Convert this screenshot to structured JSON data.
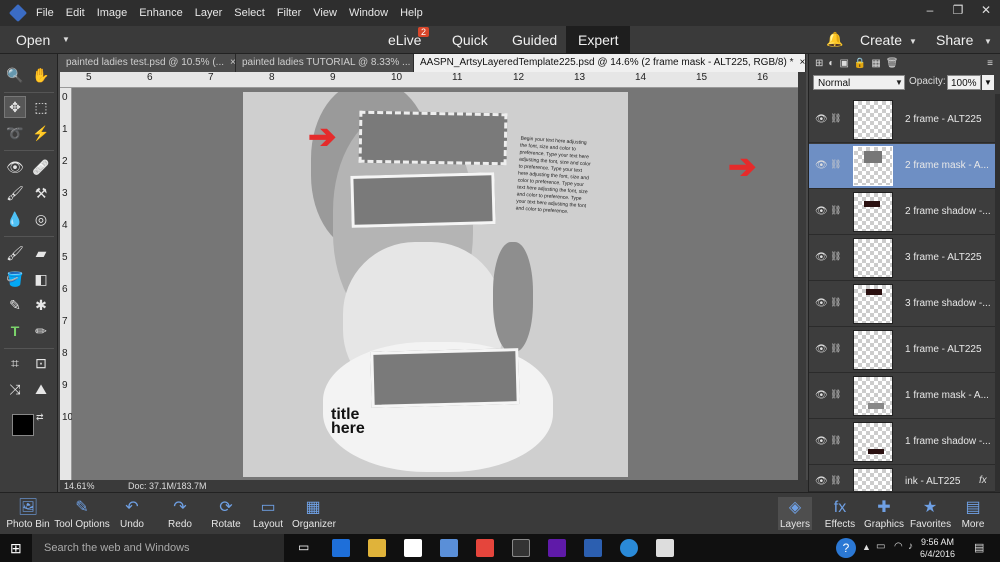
{
  "menu": [
    "File",
    "Edit",
    "Image",
    "Enhance",
    "Layer",
    "Select",
    "Filter",
    "View",
    "Window",
    "Help"
  ],
  "window_controls": [
    "–",
    "❐",
    "✕"
  ],
  "modebar": {
    "open_label": "Open",
    "modes": [
      "eLive",
      "Quick",
      "Guided",
      "Expert"
    ],
    "elive_badge": "2",
    "active_mode": "Expert",
    "create_label": "Create",
    "share_label": "Share"
  },
  "tabs": [
    {
      "label": "painted ladies test.psd @ 10.5% (...",
      "close": "×"
    },
    {
      "label": "painted ladies TUTORIAL @ 8.33% ...",
      "close": "×"
    },
    {
      "label": "AASPN_ArtsyLayeredTemplate225.psd @ 14.6% (2 frame mask - ALT225, RGB/8) *",
      "close": "×"
    }
  ],
  "ruler_h": [
    "5",
    "6",
    "7",
    "8",
    "9",
    "10",
    "11",
    "12",
    "13",
    "14",
    "15",
    "16"
  ],
  "ruler_v": [
    "0",
    "1",
    "2",
    "3",
    "4",
    "5",
    "6",
    "7",
    "8",
    "9",
    "10"
  ],
  "canvas": {
    "journal_text": "Begin your text here adjusting the font, size and color to preference. Type your text here adjusting the font, size and color to preference. Type your text here adjusting the font, size and color to preference. Type your text here adjusting the font, size and color to preference. Type your text here adjusting the font and color to preference.",
    "title_line1": "title",
    "title_line2": "here"
  },
  "status": {
    "zoom": "14.61%",
    "doc": "Doc: 37.1M/183.7M"
  },
  "layers_panel": {
    "blend_mode": "Normal",
    "opacity_label": "Opacity:",
    "opacity_value": "100%",
    "layers": [
      {
        "name": "2 frame - ALT225",
        "selected": false,
        "fx": false,
        "thumb": "empty"
      },
      {
        "name": "2 frame mask - A...",
        "selected": true,
        "fx": false,
        "thumb": "gray-block"
      },
      {
        "name": "2 frame shadow -...",
        "selected": false,
        "fx": false,
        "thumb": "dark-bar"
      },
      {
        "name": "3 frame - ALT225",
        "selected": false,
        "fx": false,
        "thumb": "empty"
      },
      {
        "name": "3 frame shadow -...",
        "selected": false,
        "fx": false,
        "thumb": "dark-bar"
      },
      {
        "name": "1 frame - ALT225",
        "selected": false,
        "fx": false,
        "thumb": "empty"
      },
      {
        "name": "1 frame mask - A...",
        "selected": false,
        "fx": false,
        "thumb": "gray-bar"
      },
      {
        "name": "1 frame shadow -...",
        "selected": false,
        "fx": false,
        "thumb": "dark-bar"
      },
      {
        "name": "ink - ALT225",
        "selected": false,
        "fx": true,
        "thumb": "empty"
      }
    ]
  },
  "bottom_buttons_left": [
    "Photo Bin",
    "Tool Options",
    "Undo",
    "Redo",
    "Rotate",
    "Layout",
    "Organizer"
  ],
  "bottom_buttons_right": [
    "Layers",
    "Effects",
    "Graphics",
    "Favorites",
    "More"
  ],
  "taskbar": {
    "search_placeholder": "Search the web and Windows",
    "time": "9:56 AM",
    "date": "6/4/2016"
  },
  "colors": {
    "accent": "#6e8fc4",
    "annotation_arrow": "#e52b2b",
    "badge": "#d9462a"
  }
}
